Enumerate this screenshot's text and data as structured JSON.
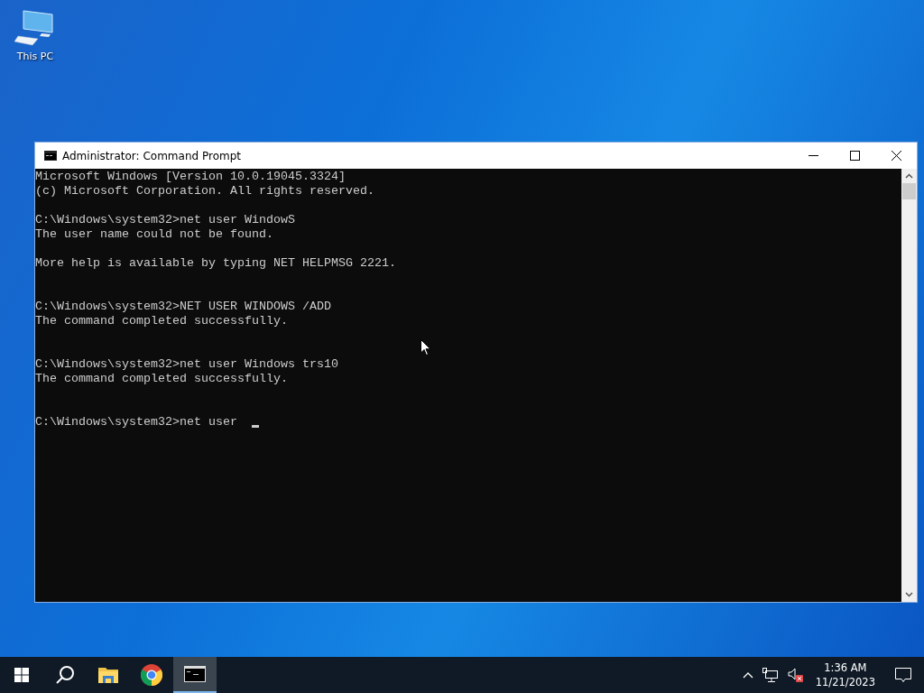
{
  "desktop_icons": [
    {
      "label": "This PC",
      "selected": false
    }
  ],
  "window": {
    "title": "Administrator: Command Prompt",
    "cursor_visible": true,
    "lines": [
      {
        "kind": "banner",
        "text": "Microsoft Windows [Version 10.0.19045.3324]"
      },
      {
        "kind": "banner",
        "text": "(c) Microsoft Corporation. All rights reserved."
      },
      {
        "kind": "command",
        "text": "C:\\Windows\\system32>net user WindowS"
      },
      {
        "kind": "output",
        "text": "The user name could not be found."
      },
      {
        "kind": "note",
        "text": "More help is available by typing NET HELPMSG 2221."
      },
      {
        "kind": "command",
        "text": "C:\\Windows\\system32>NET USER WINDOWS /ADD"
      },
      {
        "kind": "output",
        "text": "The command completed successfully."
      },
      {
        "kind": "command",
        "text": "C:\\Windows\\system32>net user Windows trs10"
      },
      {
        "kind": "output",
        "text": "The command completed successfully."
      },
      {
        "kind": "command",
        "text": "C:\\Windows\\system32>net user"
      }
    ]
  },
  "taskbar": {
    "items": [
      {
        "kind": "start",
        "selected": false
      },
      {
        "kind": "search",
        "selected": false
      },
      {
        "kind": "explorer",
        "selected": false
      },
      {
        "kind": "chrome",
        "selected": false
      },
      {
        "kind": "cmd",
        "selected": true
      }
    ],
    "tray": {
      "volume_muted": true,
      "time": "1:36 AM",
      "date": "11/21/2023"
    }
  }
}
